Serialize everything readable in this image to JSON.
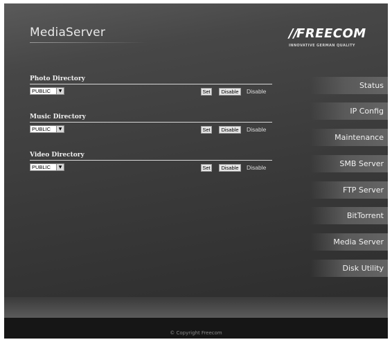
{
  "header": {
    "title": "MediaServer",
    "brand": {
      "slashes": "//",
      "name": "FREECOM",
      "tagline": "INNOVATIVE GERMAN QUALITY"
    }
  },
  "directories": [
    {
      "title": "Photo Directory",
      "selected": "PUBLIC",
      "set_label": "Set",
      "disable_label": "Disable",
      "status": "Disable"
    },
    {
      "title": "Music Directory",
      "selected": "PUBLIC",
      "set_label": "Set",
      "disable_label": "Disable",
      "status": "Disable"
    },
    {
      "title": "Video Directory",
      "selected": "PUBLIC",
      "set_label": "Set",
      "disable_label": "Disable",
      "status": "Disable"
    }
  ],
  "sidebar": {
    "items": [
      {
        "label": "Status"
      },
      {
        "label": "IP Config"
      },
      {
        "label": "Maintenance"
      },
      {
        "label": "SMB Server"
      },
      {
        "label": "FTP Server"
      },
      {
        "label": "BitTorrent"
      },
      {
        "label": "Media Server"
      },
      {
        "label": "Disk Utility"
      }
    ]
  },
  "footer": {
    "copyright": "© Copyright Freecom"
  },
  "colors": {
    "background": "#3a3a3a",
    "nav_item": "#5a5a5a",
    "footer": "#161616"
  }
}
